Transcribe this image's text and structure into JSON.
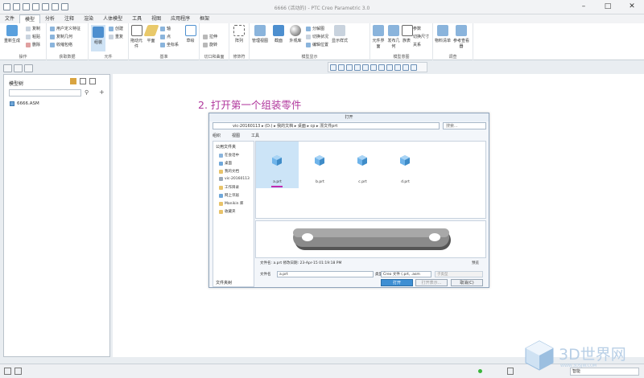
{
  "window": {
    "title": "6666 (活动的) - PTC Creo Parametric 3.0",
    "min": "–",
    "max": "□",
    "close": "✕"
  },
  "menu": [
    "文件",
    "模型",
    "分析",
    "注释",
    "渲染",
    "人体模型",
    "工具",
    "视图",
    "应用程序",
    "框架"
  ],
  "active_menu": "模型",
  "ribbon": {
    "groups": [
      {
        "label": "操作",
        "big": "重新生成",
        "small": [
          "复制",
          "粘贴",
          "删除"
        ]
      },
      {
        "label": "获取数据",
        "small": [
          "用户定义特征",
          "复制几何",
          "收缩包络"
        ]
      },
      {
        "label": "元件",
        "big": "组装",
        "small": [
          "创建",
          "重复"
        ]
      },
      {
        "label": "基准",
        "bigs": [
          "拖动元件",
          "平面",
          "草绘"
        ],
        "small": [
          "轴",
          "点",
          "坐标系"
        ]
      },
      {
        "label": "切口和曲面",
        "small": [
          "拉伸",
          "旋转"
        ]
      },
      {
        "label": "修饰符",
        "bigs": [
          "阵列"
        ]
      },
      {
        "label": "模型显示",
        "bigs": [
          "管理视图",
          "截面",
          "外观库",
          "显示样式"
        ],
        "small": [
          "分解图",
          "编辑位置",
          "切换状况"
        ]
      },
      {
        "label": "模型意图",
        "bigs": [
          "元件界面",
          "发布几何",
          "族表"
        ],
        "small": [
          "参数",
          "切换尺寸",
          "关系"
        ]
      },
      {
        "label": "调查",
        "bigs": [
          "物料清单",
          "参考查看器"
        ]
      }
    ]
  },
  "model_tree": {
    "header": "模型树",
    "items": [
      {
        "label": "6666.ASM"
      }
    ]
  },
  "annotation": "2. 打开第一个组装零件",
  "dialog": {
    "title": "打开",
    "path": "vic-20160113 ▸ (D:) ▸ 我的文档 ▸ 桌面 ▸ cp ▸ 漂文件prt",
    "search_placeholder": "搜索...",
    "toolbar": [
      "组织",
      "视图",
      "工具"
    ],
    "nav_title": "公用文件夹",
    "nav_items": [
      "在会话中",
      "桌面",
      "我的文档",
      "vic-20160113",
      "工作目录",
      "网上邻居",
      "Manikin 库",
      "收藏夹"
    ],
    "folder_tree": "文件夹树",
    "files": [
      {
        "name": "a.prt",
        "selected": true
      },
      {
        "name": "b.prt",
        "selected": false
      },
      {
        "name": "c.prt",
        "selected": false
      },
      {
        "name": "d.prt",
        "selected": false
      }
    ],
    "info": "文件名: a.prt  修改日期: 23-Apr-15 01:19:18 PM",
    "preview_label": "预览",
    "filename_label": "文件名",
    "filename_value": "a.prt",
    "type_label": "类型",
    "type_value": "Creo 文件 (.prt, .asm",
    "subtype_placeholder": "子类型",
    "buttons": {
      "open": "打开",
      "open_rep": "打开表示...",
      "cancel": "取消(C)"
    }
  },
  "status": {
    "mode": "智能"
  },
  "watermark": {
    "text": "3D世界网",
    "url": "WWW.3DSJW.COM"
  },
  "colors": {
    "accent": "#3e8fd3",
    "annotation": "#b0369c",
    "selected": "#cce4f7",
    "cube": "#6fa7d9"
  }
}
